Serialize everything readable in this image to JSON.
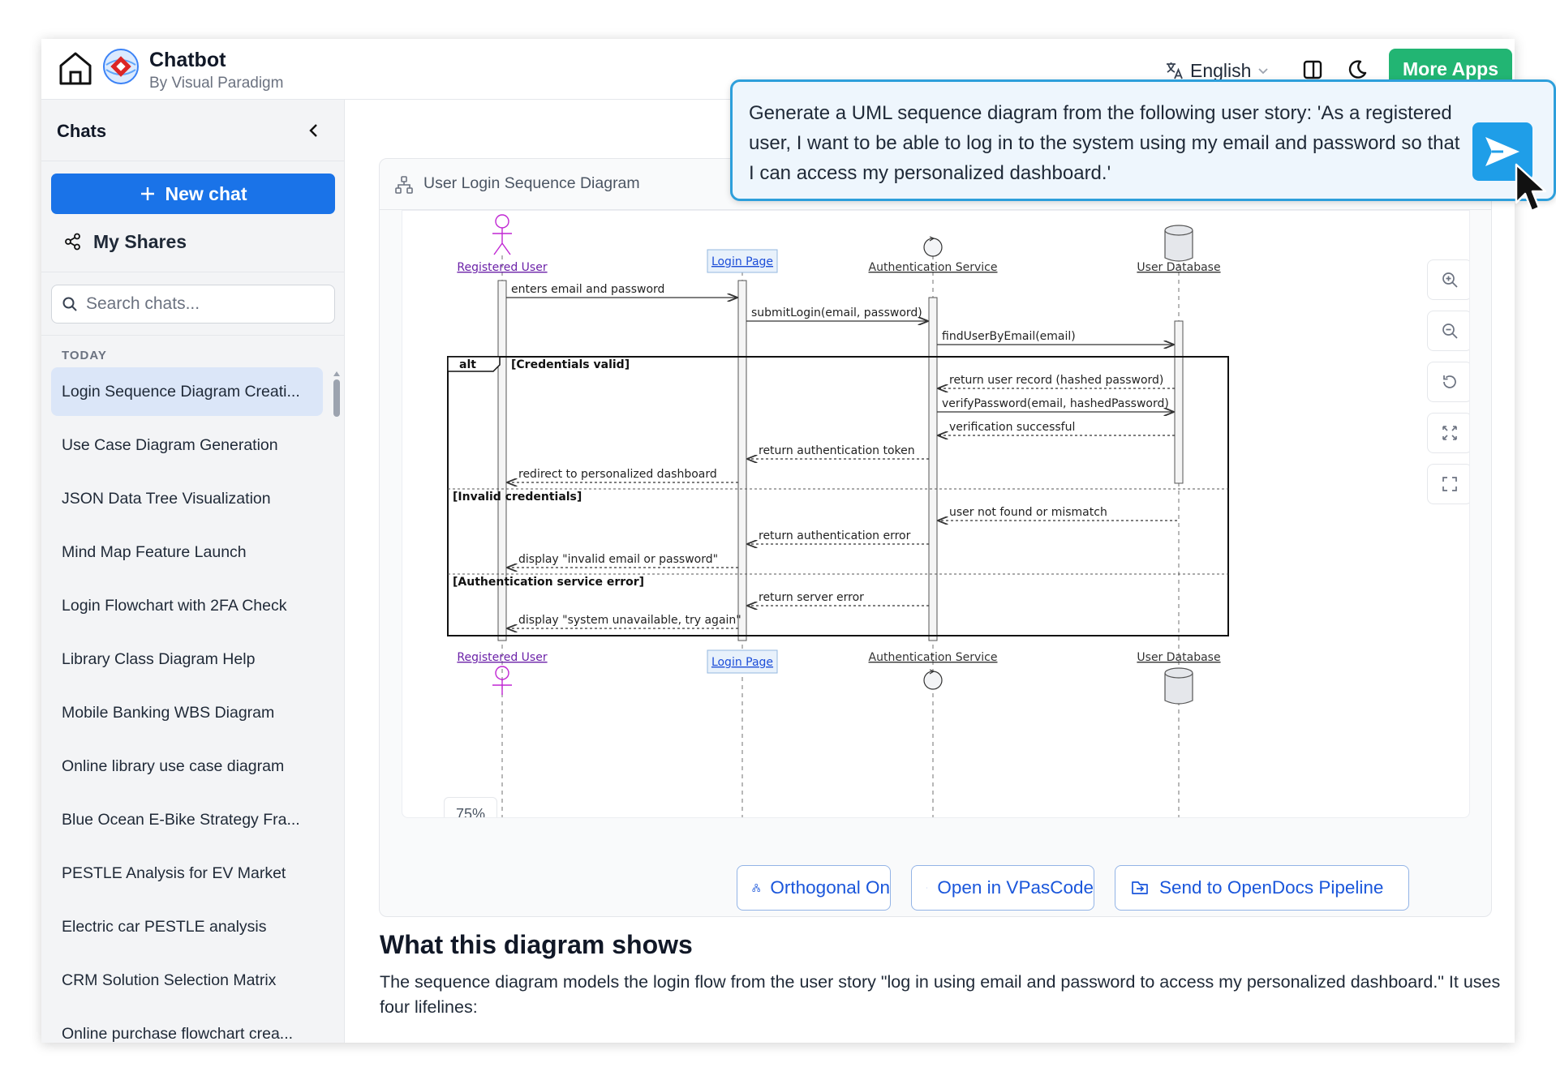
{
  "header": {
    "title": "Chatbot",
    "subtitle": "By Visual Paradigm",
    "language": "English",
    "more_apps": "More Apps"
  },
  "sidebar": {
    "title": "Chats",
    "new_chat": "New chat",
    "my_shares": "My Shares",
    "search_placeholder": "Search chats...",
    "section_label": "TODAY",
    "items": [
      {
        "label": "Login Sequence Diagram Creati..."
      },
      {
        "label": "Use Case Diagram Generation"
      },
      {
        "label": "JSON Data Tree Visualization"
      },
      {
        "label": "Mind Map Feature Launch"
      },
      {
        "label": "Login Flowchart with 2FA Check"
      },
      {
        "label": "Library Class Diagram Help"
      },
      {
        "label": "Mobile Banking WBS Diagram"
      },
      {
        "label": "Online library use case diagram"
      },
      {
        "label": "Blue Ocean E-Bike Strategy Fra..."
      },
      {
        "label": "PESTLE Analysis for EV Market"
      },
      {
        "label": "Electric car PESTLE analysis"
      },
      {
        "label": "CRM Solution Selection Matrix"
      },
      {
        "label": "Online purchase flowchart crea..."
      }
    ]
  },
  "diagram_card": {
    "title": "User Login Sequence Diagram",
    "zoom": "75%",
    "actions": {
      "orthogonal": "Orthogonal On",
      "open_vpascode": "Open in VPasCode",
      "send_opendocs": "Send to OpenDocs Pipeline"
    }
  },
  "diagram": {
    "lifelines": [
      "Registered User",
      "Login Page",
      "Authentication Service",
      "User Database"
    ],
    "fragment_operator": "alt",
    "guards": [
      "[Credentials valid]",
      "[Invalid credentials]",
      "[Authentication service error]"
    ],
    "messages": [
      "enters email and password",
      "submitLogin(email, password)",
      "findUserByEmail(email)",
      "return user record (hashed password)",
      "verifyPassword(email, hashedPassword)",
      "verification successful",
      "return authentication token",
      "redirect to personalized dashboard",
      "user not found or mismatch",
      "return authentication error",
      "display \"invalid email or password\"",
      "return server error",
      "display \"system unavailable, try again\""
    ]
  },
  "content": {
    "heading": "What this diagram shows",
    "paragraph": "The sequence diagram models the login flow from the user story \"log in using email and password to access my personalized dashboard.\" It uses four lifelines:"
  },
  "prompt": {
    "text": "Generate a UML sequence diagram from the following user story: 'As a registered user, I want to be able to log in to the system using my email and password so that I can access my personalized dashboard.'"
  },
  "colors": {
    "primary": "#1a73e8",
    "more_apps": "#22b573",
    "send": "#1f9ee8",
    "prompt_border": "#2d9fdb"
  }
}
